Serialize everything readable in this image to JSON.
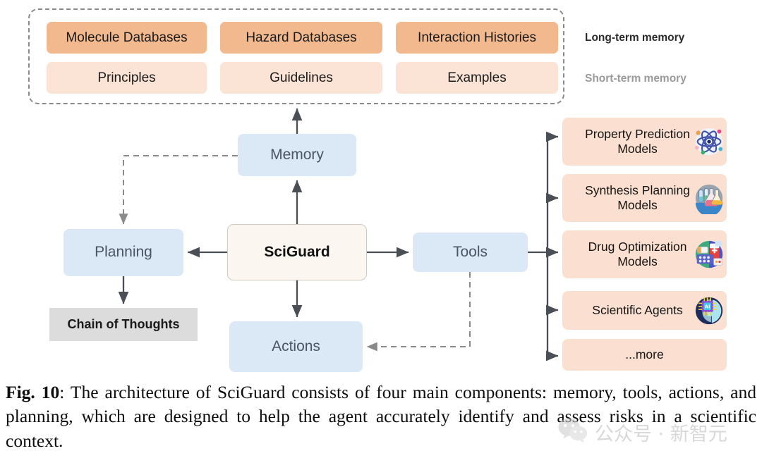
{
  "memory_group": {
    "long_term": {
      "label": "Long-term memory",
      "items": [
        "Molecule Databases",
        "Hazard Databases",
        "Interaction Histories"
      ]
    },
    "short_term": {
      "label": "Short-term memory",
      "items": [
        "Principles",
        "Guidelines",
        "Examples"
      ]
    },
    "colors": {
      "long_term_fill": "#f2b98f",
      "short_term_fill": "#fbe3d6",
      "border": "#8a8a8a"
    }
  },
  "core": {
    "center": "SciGuard",
    "memory": "Memory",
    "planning": "Planning",
    "tools": "Tools",
    "actions": "Actions",
    "chain_of_thoughts": "Chain of Thoughts",
    "colors": {
      "core_fill": "#dbe8f6",
      "center_fill": "#fbf7f0",
      "cot_fill": "#dcdcdc"
    }
  },
  "tools_list": {
    "fill": "#fbe0d1",
    "items": [
      {
        "label": "Property Prediction Models",
        "icon": "atom-icon"
      },
      {
        "label": "Synthesis Planning Models",
        "icon": "lab-flasks-icon"
      },
      {
        "label": "Drug Optimization Models",
        "icon": "pills-icon"
      },
      {
        "label": "Scientific Agents",
        "icon": "ai-head-icon"
      },
      {
        "label": "...more",
        "icon": ""
      }
    ]
  },
  "caption": {
    "figure_number": "Fig. 10",
    "separator": ": ",
    "text": "The architecture of SciGuard consists of four main components: memory, tools, actions, and planning, which are designed to help the agent accurately identify and assess risks in a scientific context."
  },
  "watermark": {
    "text": "公众号 · 新智元",
    "icon": "wechat-icon"
  }
}
